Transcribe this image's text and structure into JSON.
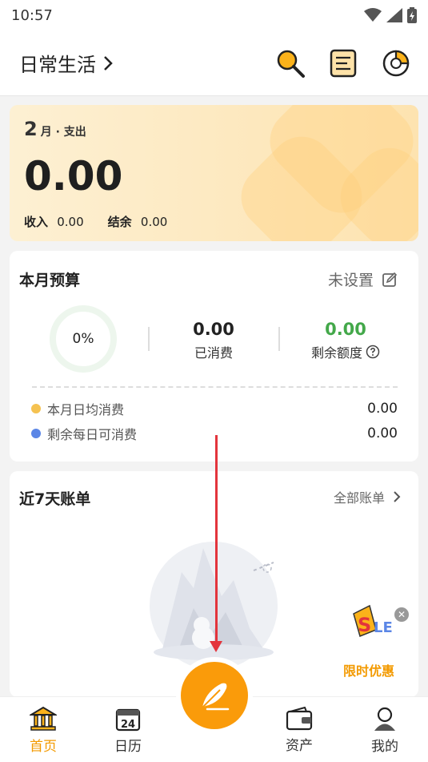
{
  "status_bar": {
    "time": "10:57"
  },
  "header": {
    "title": "日常生活"
  },
  "hero": {
    "month_num": "2",
    "month_label": "月 · 支出",
    "amount": "0.00",
    "income_label": "收入",
    "income_value": "0.00",
    "balance_label": "结余",
    "balance_value": "0.00"
  },
  "budget": {
    "title": "本月预算",
    "set_label": "未设置",
    "percent": "0%",
    "spent_value": "0.00",
    "spent_label": "已消费",
    "remaining_value": "0.00",
    "remaining_label": "剩余额度",
    "rows": [
      {
        "label": "本月日均消费",
        "value": "0.00",
        "color": "#f5c251"
      },
      {
        "label": "剩余每日可消费",
        "value": "0.00",
        "color": "#5b86e6"
      }
    ]
  },
  "bills": {
    "title": "近7天账单",
    "all_label": "全部账单",
    "sale_label": "限时优惠"
  },
  "tabs": [
    {
      "label": "首页",
      "active": true
    },
    {
      "label": "日历",
      "active": false
    },
    {
      "label": "资产",
      "active": false
    },
    {
      "label": "我的",
      "active": false
    }
  ],
  "colors": {
    "accent": "#f39a00",
    "fab": "#fa9b0a",
    "arrow": "#e3343c",
    "remaining": "#43a84a"
  }
}
